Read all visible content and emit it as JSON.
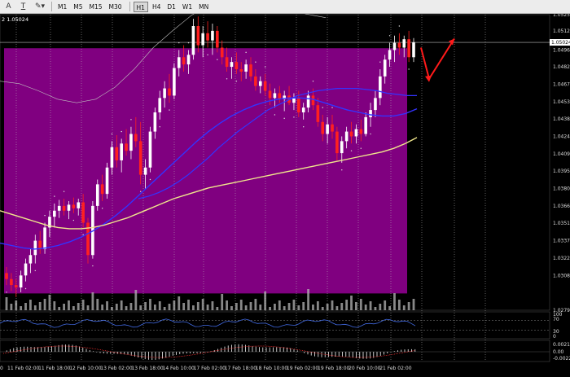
{
  "toolbar": {
    "tool_icons": [
      "text-label-icon",
      "text-box-icon",
      "shapes-dropdown-icon"
    ],
    "tool_glyphs": [
      "A",
      "T",
      "✎▾"
    ],
    "timeframes": [
      "M1",
      "M5",
      "M15",
      "M30",
      "H1",
      "H4",
      "D1",
      "W1",
      "MN"
    ],
    "active_timeframe": "H1"
  },
  "chart_header": {
    "symbol_fragment": "2 1.05024"
  },
  "colors": {
    "zone": "#800080",
    "bull_candle": "#ffffff",
    "bear_candle": "#ff2020",
    "ma_fast": "#3333ff",
    "ma_slow": "#f0e68c",
    "bollinger": "#bfbfbf",
    "arrow": "#ff1a1a",
    "grid": "#c0c0c0",
    "rsi_line": "#4169e1",
    "volume": "#b5b5b5"
  },
  "chart_data": {
    "type": "candlestick",
    "title": "",
    "price_axis_labels": [
      "1.05255",
      "1.05120",
      "1.04960",
      "1.04820",
      "1.04675",
      "1.04530",
      "1.04385",
      "1.04240",
      "1.04095",
      "1.03950",
      "1.03805",
      "1.03660",
      "1.03515",
      "1.03370",
      "1.03225",
      "1.03080",
      "1.02790"
    ],
    "ylim": [
      1.0279,
      1.05255
    ],
    "current_price_label": "1.05024",
    "time_axis_labels": [
      "11 Feb 02:00",
      "11 Feb 18:00",
      "12 Feb 10:00",
      "13 Feb 02:00",
      "13 Feb 18:00",
      "14 Feb 10:00",
      "17 Feb 02:00",
      "17 Feb 18:00",
      "18 Feb 10:00",
      "19 Feb 02:00",
      "19 Feb 18:00",
      "20 Feb 10:00",
      "21 Feb 02:00"
    ],
    "time_axis_left_fragment": "0",
    "rsi_axis_labels": [
      "100",
      "70",
      "30",
      "0"
    ],
    "macd_axis_labels": [
      "0.002151",
      "0.00",
      "-0.00223"
    ],
    "candles_ohlc": [
      [
        1.031,
        1.0315,
        1.03,
        1.0305
      ],
      [
        1.0305,
        1.031,
        1.0295,
        1.03
      ],
      [
        1.03,
        1.0305,
        1.029,
        1.0298
      ],
      [
        1.0298,
        1.0312,
        1.0294,
        1.0308
      ],
      [
        1.0308,
        1.0322,
        1.0303,
        1.0318
      ],
      [
        1.0318,
        1.033,
        1.031,
        1.0325
      ],
      [
        1.0325,
        1.0342,
        1.0318,
        1.0337
      ],
      [
        1.0337,
        1.0345,
        1.0326,
        1.033
      ],
      [
        1.033,
        1.0352,
        1.0326,
        1.0348
      ],
      [
        1.0348,
        1.0362,
        1.034,
        1.0357
      ],
      [
        1.0357,
        1.0368,
        1.0348,
        1.0362
      ],
      [
        1.0362,
        1.0371,
        1.0356,
        1.0366
      ],
      [
        1.0366,
        1.0372,
        1.0358,
        1.0362
      ],
      [
        1.0362,
        1.037,
        1.0355,
        1.0367
      ],
      [
        1.0367,
        1.0373,
        1.036,
        1.0364
      ],
      [
        1.0364,
        1.0372,
        1.0358,
        1.0369
      ],
      [
        1.0369,
        1.0376,
        1.0348,
        1.0352
      ],
      [
        1.0352,
        1.0356,
        1.0318,
        1.0325
      ],
      [
        1.0325,
        1.037,
        1.0322,
        1.0366
      ],
      [
        1.0366,
        1.0388,
        1.0362,
        1.0384
      ],
      [
        1.0384,
        1.0392,
        1.037,
        1.0376
      ],
      [
        1.0376,
        1.0402,
        1.0372,
        1.0398
      ],
      [
        1.0398,
        1.042,
        1.0392,
        1.0415
      ],
      [
        1.0415,
        1.0425,
        1.0398,
        1.0404
      ],
      [
        1.0404,
        1.0422,
        1.0394,
        1.0418
      ],
      [
        1.0418,
        1.043,
        1.0408,
        1.0412
      ],
      [
        1.0412,
        1.0432,
        1.0405,
        1.0426
      ],
      [
        1.0426,
        1.044,
        1.0415,
        1.042
      ],
      [
        1.042,
        1.0436,
        1.0384,
        1.0392
      ],
      [
        1.0392,
        1.0405,
        1.038,
        1.0398
      ],
      [
        1.0398,
        1.0432,
        1.0394,
        1.0428
      ],
      [
        1.0428,
        1.0448,
        1.0422,
        1.0444
      ],
      [
        1.0444,
        1.0462,
        1.0438,
        1.0456
      ],
      [
        1.0456,
        1.047,
        1.0448,
        1.0464
      ],
      [
        1.0464,
        1.0476,
        1.0452,
        1.0458
      ],
      [
        1.0458,
        1.0485,
        1.0455,
        1.0481
      ],
      [
        1.0481,
        1.0496,
        1.0474,
        1.049
      ],
      [
        1.049,
        1.05,
        1.0478,
        1.0484
      ],
      [
        1.0484,
        1.0496,
        1.0476,
        1.0492
      ],
      [
        1.0492,
        1.0522,
        1.0488,
        1.0516
      ],
      [
        1.0516,
        1.0524,
        1.0494,
        1.05
      ],
      [
        1.05,
        1.0516,
        1.049,
        1.051
      ],
      [
        1.051,
        1.052,
        1.0498,
        1.0504
      ],
      [
        1.0504,
        1.0518,
        1.0492,
        1.0512
      ],
      [
        1.0512,
        1.0516,
        1.0494,
        1.0498
      ],
      [
        1.0498,
        1.0504,
        1.0484,
        1.049
      ],
      [
        1.049,
        1.0498,
        1.0478,
        1.0482
      ],
      [
        1.0482,
        1.049,
        1.0472,
        1.0486
      ],
      [
        1.0486,
        1.0494,
        1.0476,
        1.048
      ],
      [
        1.048,
        1.0486,
        1.047,
        1.0478
      ],
      [
        1.0478,
        1.0488,
        1.0472,
        1.0484
      ],
      [
        1.0484,
        1.049,
        1.047,
        1.0474
      ],
      [
        1.0474,
        1.048,
        1.0462,
        1.0466
      ],
      [
        1.0466,
        1.0474,
        1.046,
        1.047
      ],
      [
        1.047,
        1.0476,
        1.0458,
        1.0462
      ],
      [
        1.0462,
        1.0468,
        1.045,
        1.0456
      ],
      [
        1.0456,
        1.0464,
        1.0448,
        1.046
      ],
      [
        1.046,
        1.0466,
        1.0452,
        1.0455
      ],
      [
        1.0455,
        1.0462,
        1.0445,
        1.0458
      ],
      [
        1.0458,
        1.0466,
        1.045,
        1.0452
      ],
      [
        1.0452,
        1.046,
        1.0446,
        1.0456
      ],
      [
        1.0456,
        1.0462,
        1.044,
        1.0444
      ],
      [
        1.0444,
        1.0452,
        1.0438,
        1.0448
      ],
      [
        1.0448,
        1.0462,
        1.0444,
        1.0458
      ],
      [
        1.0458,
        1.0464,
        1.0446,
        1.045
      ],
      [
        1.045,
        1.0456,
        1.0432,
        1.0436
      ],
      [
        1.0436,
        1.0442,
        1.042,
        1.0426
      ],
      [
        1.0426,
        1.044,
        1.0418,
        1.0434
      ],
      [
        1.0434,
        1.0442,
        1.0422,
        1.0428
      ],
      [
        1.0428,
        1.0432,
        1.0404,
        1.041
      ],
      [
        1.041,
        1.0424,
        1.0402,
        1.042
      ],
      [
        1.042,
        1.0432,
        1.0414,
        1.0428
      ],
      [
        1.0428,
        1.0436,
        1.0418,
        1.0424
      ],
      [
        1.0424,
        1.0434,
        1.0418,
        1.043
      ],
      [
        1.043,
        1.0438,
        1.042,
        1.0426
      ],
      [
        1.0426,
        1.0444,
        1.0424,
        1.044
      ],
      [
        1.044,
        1.0452,
        1.0432,
        1.0446
      ],
      [
        1.0446,
        1.0462,
        1.044,
        1.0456
      ],
      [
        1.0456,
        1.048,
        1.045,
        1.0474
      ],
      [
        1.0474,
        1.0492,
        1.0468,
        1.0488
      ],
      [
        1.0488,
        1.0502,
        1.0482,
        1.0496
      ],
      [
        1.0496,
        1.0508,
        1.0486,
        1.0502
      ],
      [
        1.0502,
        1.051,
        1.0492,
        1.0498
      ],
      [
        1.0498,
        1.0508,
        1.049,
        1.0505
      ],
      [
        1.0505,
        1.0512,
        1.0486,
        1.049
      ],
      [
        1.049,
        1.0506,
        1.0486,
        1.05024
      ]
    ],
    "series": [
      {
        "values_ma_fast": [
          1.0335,
          1.0333,
          1.0331,
          1.033,
          1.0331,
          1.0333,
          1.0336,
          1.034,
          1.0345,
          1.0351,
          1.0358,
          1.0366,
          1.0375,
          1.0384,
          1.0393,
          1.0402,
          1.0411,
          1.042,
          1.0428,
          1.0435,
          1.0441,
          1.0446,
          1.045,
          1.0453,
          1.0455,
          1.0456,
          1.0456,
          1.0455,
          1.0452,
          1.0449,
          1.0446,
          1.0444,
          1.0442,
          1.0441,
          1.0441,
          1.0443,
          1.0447
        ]
      },
      {
        "values_ma_slow": [
          1.0362,
          1.0359,
          1.0356,
          1.0353,
          1.035,
          1.0348,
          1.0347,
          1.0347,
          1.0348,
          1.035,
          1.0353,
          1.0356,
          1.036,
          1.0364,
          1.0368,
          1.0372,
          1.0375,
          1.0378,
          1.0381,
          1.0383,
          1.0385,
          1.0387,
          1.0389,
          1.0391,
          1.0393,
          1.0395,
          1.0397,
          1.0399,
          1.0401,
          1.0403,
          1.0405,
          1.0407,
          1.0409,
          1.0411,
          1.0414,
          1.0418,
          1.0423
        ]
      },
      {
        "values_ma_mid": [
          1.0372,
          1.0374,
          1.0377,
          1.0381,
          1.0386,
          1.0392,
          1.0399,
          1.0406,
          1.0414,
          1.0421,
          1.0428,
          1.0434,
          1.044,
          1.0446,
          1.045,
          1.0454,
          1.0458,
          1.046,
          1.0462,
          1.0463,
          1.0464,
          1.0464,
          1.0464,
          1.0463,
          1.0462,
          1.046,
          1.0459,
          1.0458,
          1.0458
        ]
      }
    ],
    "ma_fast_label": "",
    "zone": {
      "price_top": 1.04975,
      "price_bottom": 1.0293
    },
    "projection_arrow": {
      "points_price": [
        1.0498,
        1.0472,
        1.05055
      ]
    }
  }
}
